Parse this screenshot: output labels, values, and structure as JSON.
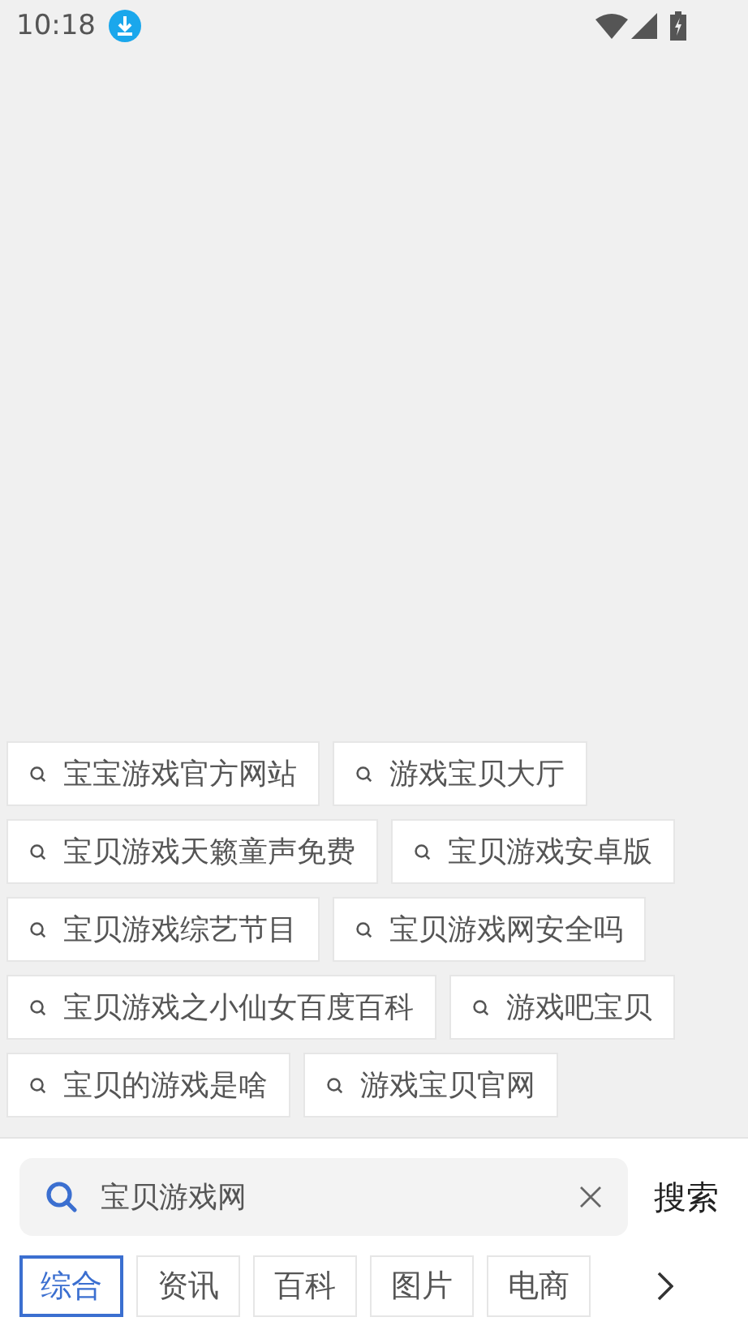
{
  "status_bar": {
    "time": "10:18"
  },
  "suggestions": [
    "宝宝游戏官方网站",
    "游戏宝贝大厅",
    "宝贝游戏天籁童声免费",
    "宝贝游戏安卓版",
    "宝贝游戏综艺节目",
    "宝贝游戏网安全吗",
    "宝贝游戏之小仙女百度百科",
    "游戏吧宝贝",
    "宝贝的游戏是啥",
    "游戏宝贝官网"
  ],
  "search": {
    "value": "宝贝游戏网",
    "button": "搜索"
  },
  "tabs": [
    {
      "label": "综合",
      "selected": true
    },
    {
      "label": "资讯",
      "selected": false
    },
    {
      "label": "百科",
      "selected": false
    },
    {
      "label": "图片",
      "selected": false
    },
    {
      "label": "电商",
      "selected": false
    }
  ]
}
